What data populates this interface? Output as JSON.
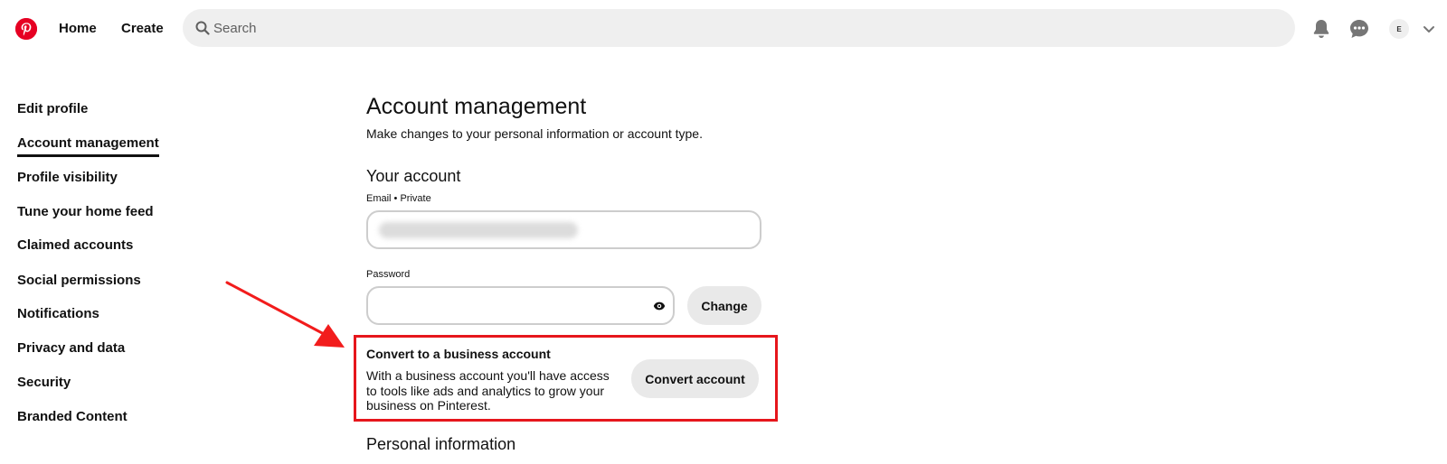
{
  "header": {
    "logo_icon": "pinterest-logo-icon",
    "brand_color": "#e60023",
    "nav": {
      "home": "Home",
      "create": "Create"
    },
    "search": {
      "placeholder": "Search",
      "value": ""
    },
    "icons": [
      "bell-icon",
      "chat-icon"
    ],
    "avatar_initial": "E"
  },
  "sidebar": {
    "items": [
      {
        "label": "Edit profile",
        "active": false
      },
      {
        "label": "Account management",
        "active": true
      },
      {
        "label": "Profile visibility",
        "active": false
      },
      {
        "label": "Tune your home feed",
        "active": false
      },
      {
        "label": "Claimed accounts",
        "active": false
      },
      {
        "label": "Social permissions",
        "active": false
      },
      {
        "label": "Notifications",
        "active": false
      },
      {
        "label": "Privacy and data",
        "active": false
      },
      {
        "label": "Security",
        "active": false
      },
      {
        "label": "Branded Content",
        "active": false
      }
    ]
  },
  "main": {
    "title": "Account management",
    "subtitle": "Make changes to your personal information or account type.",
    "your_account": {
      "heading": "Your account",
      "email_label": "Email • Private",
      "password_label": "Password",
      "password_value": "",
      "change_button": "Change"
    },
    "business": {
      "title": "Convert to a business account",
      "description": "With a business account you'll have access to tools like ads and analytics to grow your business on Pinterest.",
      "button": "Convert account",
      "highlight_color": "#e6161c"
    },
    "personal_information_heading": "Personal information"
  },
  "annotation": {
    "arrow_color": "#f21c1c"
  }
}
